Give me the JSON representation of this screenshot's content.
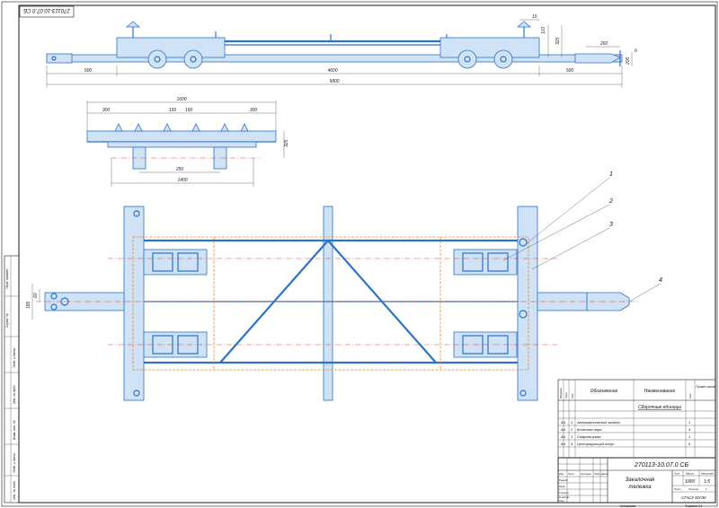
{
  "drawing_code_top": "270113-10.07.0 СБ",
  "dimensions": {
    "d15": "15",
    "d110": "110",
    "d325a": "325",
    "d260": "260",
    "d6": "6",
    "d500_left": "500",
    "d4600": "4600",
    "d500_right": "500",
    "d5800": "5800",
    "d1600": "1600",
    "d300_a": "300",
    "d150_a": "150",
    "d150_b": "150",
    "d300_b": "300",
    "d325b": "325",
    "d250": "250",
    "d1400": "1400",
    "d60": "60",
    "d185": "185",
    "d200": "200"
  },
  "callouts": [
    "1",
    "2",
    "3",
    "4"
  ],
  "spec_table": {
    "headers": {
      "format": "Формат",
      "zone": "Зона",
      "pos": "Поз.",
      "designation": "Обозначение",
      "name": "Наименование",
      "qty": "Кол.",
      "note": "Приме-чание"
    },
    "section": "Сборочные единицы",
    "rows": [
      {
        "format": "А4",
        "pos": "1",
        "name": "Автоматический захват",
        "qty": "1"
      },
      {
        "format": "А4",
        "pos": "2",
        "name": "Колесная пара",
        "qty": "4"
      },
      {
        "format": "А4",
        "pos": "3",
        "name": "Сварная рама",
        "qty": "1"
      },
      {
        "format": "А4",
        "pos": "4",
        "name": "Центрирующий конус",
        "qty": "6"
      }
    ]
  },
  "title_block": {
    "code": "270113-10.07.0 СБ",
    "title_line1": "Закалочная",
    "title_line2": "тележка",
    "col_lit": "Лит.",
    "col_mass": "Масса",
    "col_scale": "Масштаб",
    "mass": "1000",
    "scale": "1:5",
    "sheet": "Лист",
    "sheets": "Листов",
    "sheets_count": "1",
    "org": "СГАСУ МУЭК",
    "rows_labels": [
      "Изм",
      "Лист",
      "№ докум.",
      "Подп.",
      "Дата"
    ],
    "roles": [
      "Разраб.",
      "Пров.",
      "Т.контр.",
      "",
      "Н.контр.",
      "Утв."
    ],
    "copied": "Копировал",
    "format": "Формат  А1"
  },
  "side_stamps": [
    "Перв. примен.",
    "Справ. №",
    "Подп. и дата",
    "Инв. № дубл.",
    "Взам. инв. №",
    "Подп. и дата",
    "Инв. № подл."
  ]
}
